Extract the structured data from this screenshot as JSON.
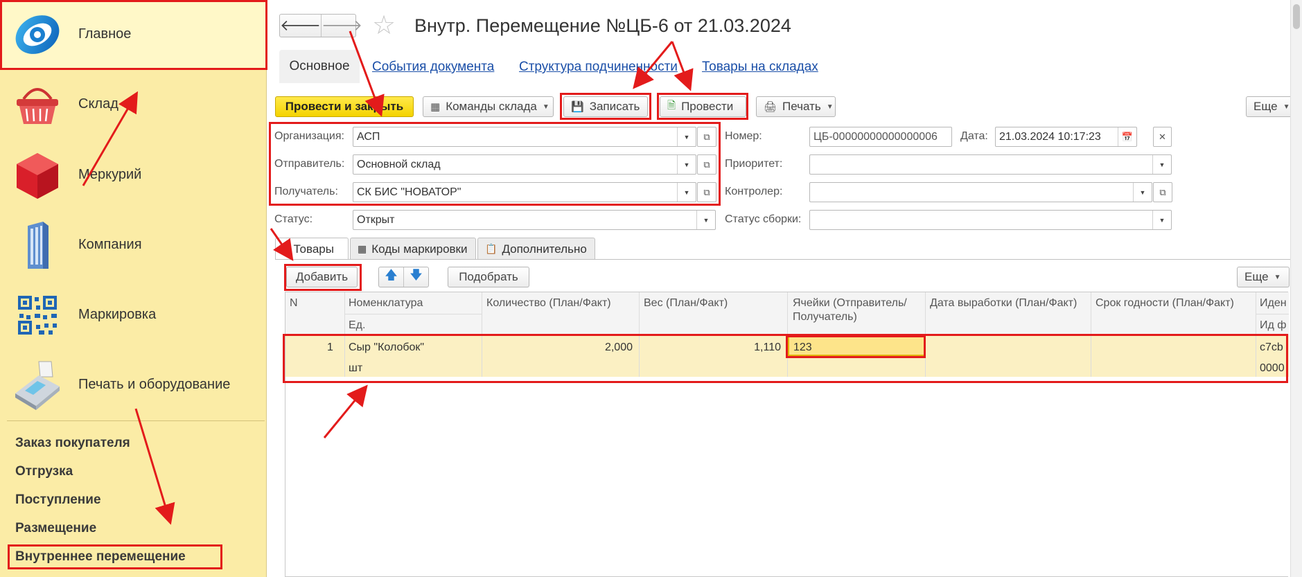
{
  "sidebar": {
    "sections": [
      {
        "label": "Главное",
        "icon": "main-logo-icon"
      },
      {
        "label": "Склад",
        "icon": "shopping-basket-icon"
      },
      {
        "label": "Меркурий",
        "icon": "cube-icon"
      },
      {
        "label": "Компания",
        "icon": "building-icon"
      },
      {
        "label": "Маркировка",
        "icon": "qr-code-icon"
      },
      {
        "label": "Печать и оборудование",
        "icon": "printer-terminal-icon"
      }
    ],
    "links": [
      "Заказ покупателя",
      "Отгрузка",
      "Поступление",
      "Размещение",
      "Внутреннее перемещение"
    ]
  },
  "header": {
    "back_icon": "arrow-left-icon",
    "forward_icon": "arrow-right-icon",
    "favorite_icon": "star-icon",
    "title": "Внутр. Перемещение №ЦБ-6 от 21.03.2024"
  },
  "tabs": {
    "main": "Основное",
    "links": [
      "События документа",
      "Структура подчиненности",
      "Товары на складах"
    ]
  },
  "toolbar": {
    "post_close": "Провести и закрыть",
    "warehouse_cmds": "Команды склада",
    "save": "Записать",
    "post": "Провести",
    "print": "Печать",
    "more": "Еще"
  },
  "form": {
    "org_label": "Организация:",
    "org_value": "АСП",
    "sender_label": "Отправитель:",
    "sender_value": "Основной склад",
    "receiver_label": "Получатель:",
    "receiver_value": "СК БИС \"НОВАТОР\"",
    "status_label": "Статус:",
    "status_value": "Открыт",
    "number_label": "Номер:",
    "number_value": "ЦБ-00000000000000006",
    "date_label": "Дата:",
    "date_value": "21.03.2024 10:17:23",
    "priority_label": "Приоритет:",
    "priority_value": "",
    "controller_label": "Контролер:",
    "controller_value": "",
    "assembly_label": "Статус сборки:",
    "assembly_value": ""
  },
  "inner_tabs": [
    "Товары",
    "Коды маркировки",
    "Дополнительно"
  ],
  "table_toolbar": {
    "add": "Добавить",
    "select": "Подобрать",
    "more": "Еще"
  },
  "table": {
    "headers": {
      "n": "N",
      "nomenclature": "Номенклатура",
      "unit": "Ед.",
      "qty": "Количество (План/Факт)",
      "weight": "Вес (План/Факт)",
      "cells": "Ячейки (Отправитель/ Получатель)",
      "prod_date": "Дата выработки (План/Факт)",
      "expiry": "Срок годности (План/Факт)",
      "ident": "Иден",
      "ident_sub": "Ид ф"
    },
    "rows": [
      {
        "n": "1",
        "name": "Сыр \"Колобок\"",
        "unit": "шт",
        "qty": "2,000",
        "weight": "1,110",
        "cells": "123",
        "ident": "c7cb",
        "ident_sub": "0000"
      }
    ]
  },
  "colors": {
    "accent_yellow": "#f4d300",
    "sidebar_bg": "#fbeca6",
    "annotation_red": "#e31b1b",
    "link_blue": "#1b4fa8"
  }
}
